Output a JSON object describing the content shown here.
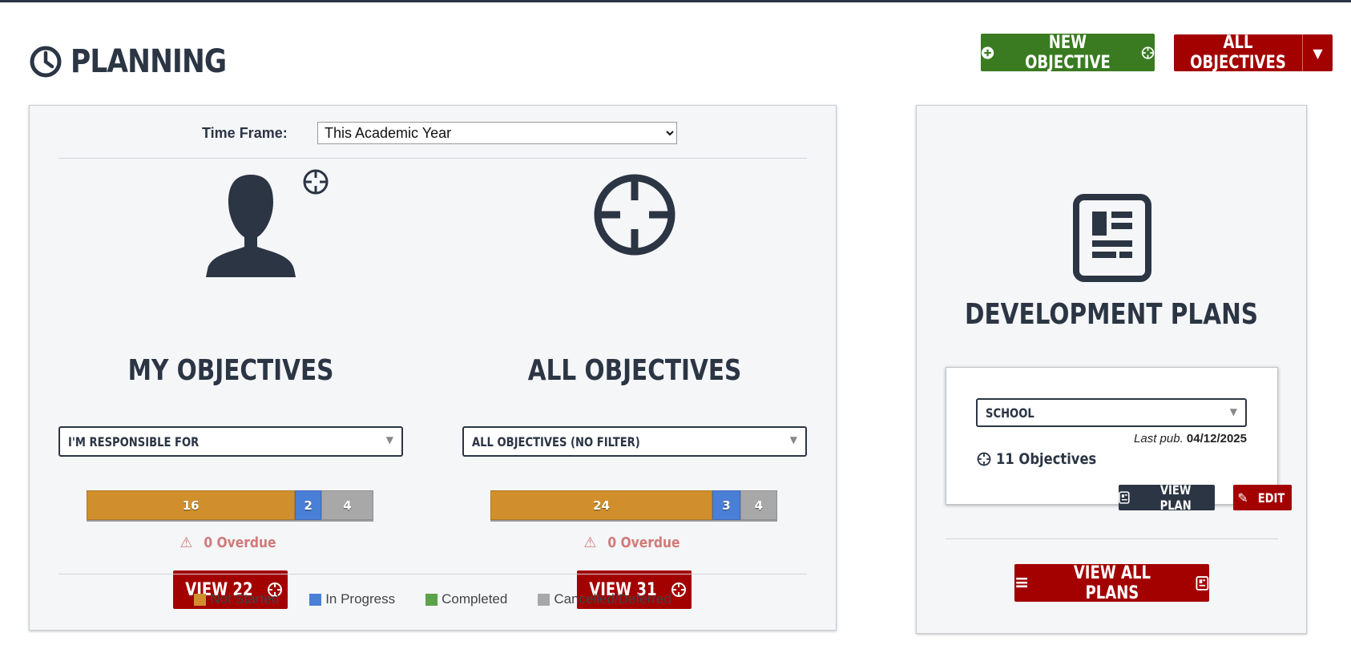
{
  "header": {
    "title": "PLANNING",
    "new_objective_label": "NEW OBJECTIVE",
    "all_objectives_label": "ALL OBJECTIVES"
  },
  "time_frame": {
    "label": "Time Frame:",
    "selected": "This Academic Year"
  },
  "my_objectives": {
    "title": "MY OBJECTIVES",
    "filter": "I'M RESPONSIBLE FOR",
    "bar": {
      "not_started": 16,
      "in_progress": 2,
      "cancelled": 4
    },
    "overdue": "0 Overdue",
    "view_label": "VIEW 22"
  },
  "all_objectives": {
    "title": "ALL OBJECTIVES",
    "filter": "ALL OBJECTIVES (NO FILTER)",
    "bar": {
      "not_started": 24,
      "in_progress": 3,
      "cancelled": 4
    },
    "overdue": "0 Overdue",
    "view_label": "VIEW 31"
  },
  "legend": [
    {
      "label": "Not Started",
      "color": "#d08f2c"
    },
    {
      "label": "In Progress",
      "color": "#4a7fd6"
    },
    {
      "label": "Completed",
      "color": "#5aa34a"
    },
    {
      "label": "Cancelled/Deferred",
      "color": "#a8a8a8"
    }
  ],
  "development_plans": {
    "title": "DEVELOPMENT PLANS",
    "plan_select": "SCHOOL",
    "last_pub_label": "Last pub.",
    "last_pub_date": "04/12/2025",
    "objective_count": "11 Objectives",
    "view_plan_label": "VIEW PLAN",
    "edit_label": "EDIT",
    "view_all_label": "VIEW ALL PLANS"
  },
  "colors": {
    "primary_dark": "#2b3544",
    "danger_red": "#a30000",
    "success_green": "#3a7b22",
    "not_started": "#d08f2c",
    "in_progress": "#4a7fd6",
    "cancelled": "#a8a8a8"
  },
  "icons": {
    "title": "clock-icon",
    "new_objective": [
      "plus-circle-icon",
      "crosshair-icon"
    ],
    "all_objectives_menu": "caret-down-icon",
    "my_objectives": [
      "user-silhouette-icon",
      "crosshair-icon"
    ],
    "all_objectives": "crosshair-icon",
    "overdue": "warning-icon",
    "view_buttons": "crosshair-icon",
    "development_plans": "newspaper-icon",
    "objective_count": "crosshair-icon",
    "view_plan": "newspaper-icon",
    "edit": "pencil-icon",
    "view_all_plans": [
      "menu-icon",
      "newspaper-icon"
    ]
  }
}
